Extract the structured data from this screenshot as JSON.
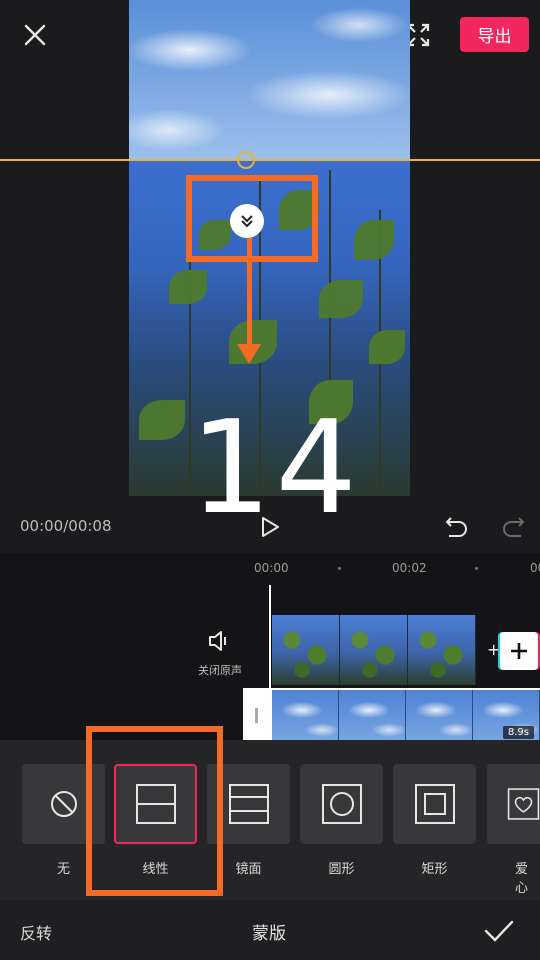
{
  "header": {
    "close_icon": "close-icon",
    "fullscreen_icon": "fullscreen-icon",
    "export_label": "导出",
    "accent_color": "#f2275d"
  },
  "preview": {
    "step_number": "14",
    "annotation_color": "#f36b24",
    "mask_line_color": "#e4b43c"
  },
  "playback": {
    "time": "00:00/00:08",
    "play_icon": "play-icon",
    "undo_icon": "undo-icon",
    "redo_icon": "redo-icon"
  },
  "timeline": {
    "ruler": [
      "00:00",
      "00:02",
      "00"
    ],
    "mute_label": "关闭原声",
    "overlay_duration": "8.9s"
  },
  "mask_options": [
    {
      "label": "无",
      "icon": "none-icon"
    },
    {
      "label": "线性",
      "icon": "linear-mask-icon",
      "selected": true
    },
    {
      "label": "镜面",
      "icon": "mirror-mask-icon"
    },
    {
      "label": "圆形",
      "icon": "circle-mask-icon"
    },
    {
      "label": "矩形",
      "icon": "rectangle-mask-icon"
    },
    {
      "label": "爱心",
      "icon": "heart-mask-icon"
    }
  ],
  "bottom": {
    "invert_label": "反转",
    "title": "蒙版",
    "confirm_icon": "check-icon"
  }
}
